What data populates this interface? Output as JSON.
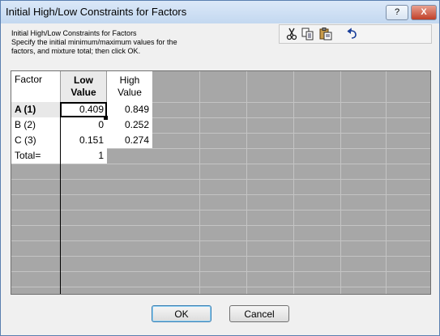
{
  "window": {
    "title": "Initial High/Low Constraints for Factors",
    "help_label": "?",
    "close_label": "X"
  },
  "intro": {
    "line1": "Initial High/Low Constraints for Factors",
    "line2": "Specify the initial minimum/maximum values for the",
    "line3": "factors, and mixture total; then click OK."
  },
  "toolbar": {
    "icons": [
      "cut-icon",
      "copy-icon",
      "paste-icon",
      "undo-icon"
    ]
  },
  "table": {
    "header_factor": "Factor",
    "header_low_1": "Low",
    "header_low_2": "Value",
    "header_high_1": "High",
    "header_high_2": "Value",
    "rows": [
      {
        "label": "A  (1)",
        "low": "0.409",
        "high": "0.849"
      },
      {
        "label": "B  (2)",
        "low": "0",
        "high": "0.252"
      },
      {
        "label": "C  (3)",
        "low": "0.151",
        "high": "0.274"
      }
    ],
    "total_label": "Total=",
    "total_value": "1"
  },
  "buttons": {
    "ok": "OK",
    "cancel": "Cancel"
  }
}
